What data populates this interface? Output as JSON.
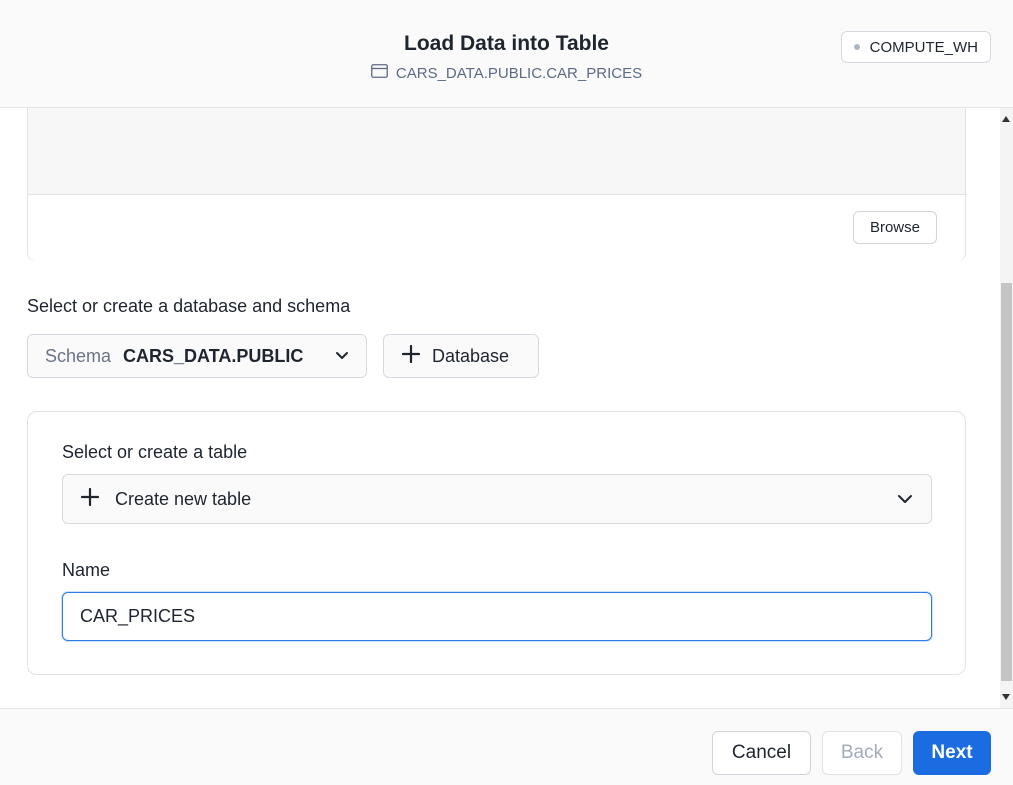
{
  "header": {
    "title": "Load Data into Table",
    "subtitle": "CARS_DATA.PUBLIC.CAR_PRICES",
    "subtitle_icon": "table-icon",
    "warehouse": "COMPUTE_WH"
  },
  "upload": {
    "browse_label": "Browse"
  },
  "schema_section": {
    "label": "Select or create a database and schema",
    "schema_prefix": "Schema",
    "schema_value": "CARS_DATA.PUBLIC",
    "add_database_label": "Database"
  },
  "table_section": {
    "label": "Select or create a table",
    "selected_option": "Create new table",
    "name_label": "Name",
    "name_value": "CAR_PRICES"
  },
  "footer": {
    "cancel_label": "Cancel",
    "back_label": "Back",
    "next_label": "Next"
  },
  "colors": {
    "accent": "#1a6ce0",
    "focus_border": "#2d7be5",
    "disabled_text": "#a3abbb"
  }
}
